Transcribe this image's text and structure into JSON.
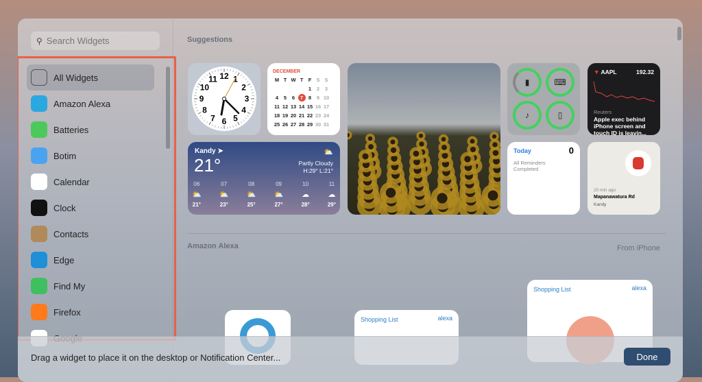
{
  "search": {
    "placeholder": "Search Widgets"
  },
  "sidebar": {
    "items": [
      {
        "label": "All Widgets",
        "icon": "all-widgets-icon",
        "color": "#5d6570"
      },
      {
        "label": "Amazon Alexa",
        "icon": "alexa-icon",
        "color": "#2aa8e0"
      },
      {
        "label": "Batteries",
        "icon": "battery-icon",
        "color": "#4cc95a"
      },
      {
        "label": "Botim",
        "icon": "botim-icon",
        "color": "#4aa3f0"
      },
      {
        "label": "Calendar",
        "icon": "calendar-icon",
        "color": "#ffffff"
      },
      {
        "label": "Clock",
        "icon": "clock-icon",
        "color": "#111111"
      },
      {
        "label": "Contacts",
        "icon": "contacts-icon",
        "color": "#b08a5a"
      },
      {
        "label": "Edge",
        "icon": "edge-icon",
        "color": "#1f8fd8"
      },
      {
        "label": "Find My",
        "icon": "find-my-icon",
        "color": "#3fbf5f"
      },
      {
        "label": "Firefox",
        "icon": "firefox-icon",
        "color": "#ff7a1a"
      },
      {
        "label": "Google",
        "icon": "google-icon",
        "color": "#ffffff"
      }
    ]
  },
  "sections": {
    "suggestions": "Suggestions",
    "alexa": "Amazon Alexa",
    "from": "From iPhone"
  },
  "calendar": {
    "month": "DECEMBER",
    "days": [
      "M",
      "T",
      "W",
      "T",
      "F",
      "S",
      "S"
    ],
    "weeks": [
      [
        "",
        "",
        "",
        "",
        "1",
        "2",
        "3"
      ],
      [
        "4",
        "5",
        "6",
        "7",
        "8",
        "9",
        "10"
      ],
      [
        "11",
        "12",
        "13",
        "14",
        "15",
        "16",
        "17"
      ],
      [
        "18",
        "19",
        "20",
        "21",
        "22",
        "23",
        "24"
      ],
      [
        "25",
        "26",
        "27",
        "28",
        "29",
        "30",
        "31"
      ]
    ],
    "today": "7"
  },
  "clock": {
    "numbers": [
      "12",
      "1",
      "2",
      "3",
      "4",
      "5",
      "6",
      "7",
      "8",
      "9",
      "10",
      "11"
    ]
  },
  "weather": {
    "city": "Kandy",
    "temp": "21°",
    "condition": "Partly Cloudy",
    "hilo": "H:29° L:21°",
    "hours": [
      {
        "h": "06",
        "t": "21°"
      },
      {
        "h": "07",
        "t": "23°"
      },
      {
        "h": "08",
        "t": "25°"
      },
      {
        "h": "09",
        "t": "27°"
      },
      {
        "h": "10",
        "t": "28°"
      },
      {
        "h": "11",
        "t": "29°"
      }
    ]
  },
  "stocks": {
    "symbol": "AAPL",
    "price": "192.32",
    "source": "Reuters",
    "headline": "Apple exec behind iPhone screen and touch ID is leavin..."
  },
  "reminders": {
    "title": "Today",
    "count": "0",
    "status": "All Reminders Completed"
  },
  "findmy": {
    "ago": "20 min ago",
    "street": "Mapanawatura Rd",
    "city": "Kandy"
  },
  "alexa": {
    "shopping": "Shopping List",
    "brand": "alexa"
  },
  "bottom": {
    "hint": "Drag a widget to place it on the desktop or Notification Center...",
    "done": "Done"
  },
  "colors": {
    "accent": "#2e4d70",
    "highlight": "#e8604a",
    "ring": "#45d060"
  }
}
